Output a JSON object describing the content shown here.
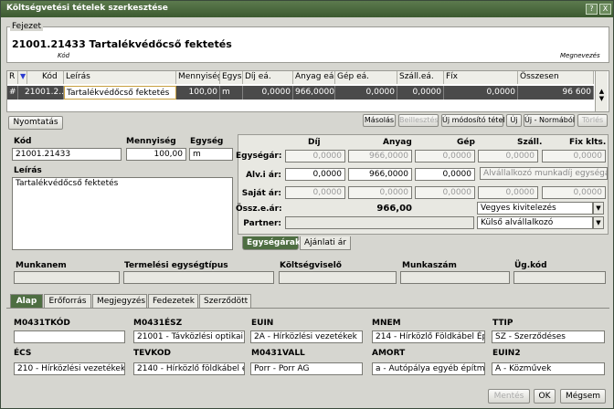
{
  "window": {
    "title": "Költségvetési tételek szerkesztése",
    "btn_help": "?",
    "btn_close": "X"
  },
  "fejezet": {
    "label": "Fejezet",
    "title": "21001.21433 Tartalékvédőcső fektetés",
    "kod_label": "Kód",
    "megnevezes_label": "Megnevezés"
  },
  "grid": {
    "headers": [
      "R",
      "",
      "Kód",
      "Leírás",
      "Mennyiség",
      "Egys.",
      "Díj eá.",
      "Anyag eá.",
      "Gép eá.",
      "Száll.eá.",
      "Fíx",
      "Összesen"
    ],
    "row": [
      "#",
      "",
      "21001.2...",
      "Tartalékvédőcső fektetés",
      "100,00",
      "m",
      "0,0000",
      "966,0000",
      "0,0000",
      "0,0000",
      "0,0000",
      "96 600"
    ]
  },
  "toolbar": {
    "print": "Nyomtatás",
    "masolas": "Másolás",
    "beillesztes": "Beillesztés",
    "uj_modosito": "Új módosító tétel",
    "uj": "Új",
    "uj_normabol": "Új - Normából",
    "torles": "Törlés"
  },
  "item": {
    "kod_label": "Kód",
    "kod": "21001.21433",
    "menny_label": "Mennyiség",
    "menny": "100,00",
    "egyseg_label": "Egység",
    "egyseg": "m",
    "leiras_label": "Leírás",
    "leiras": "Tartalékvédőcső fektetés"
  },
  "prices": {
    "cols": [
      "Díj",
      "Anyag",
      "Gép",
      "Száll.",
      "Fix klts."
    ],
    "rows": [
      {
        "label": "Egységár:",
        "vals": [
          "0,0000",
          "966,0000",
          "0,0000",
          "0,0000",
          "0,0000"
        ]
      },
      {
        "label": "Alv.i ár:",
        "vals": [
          "0,0000",
          "966,0000",
          "0,0000"
        ],
        "combo": "Alvállalkozó munkadíj egységár"
      },
      {
        "label": "Saját ár:",
        "vals": [
          "0,0000",
          "0,0000",
          "0,0000",
          "0,0000",
          "0,0000"
        ]
      }
    ],
    "ossz_label": "Össz.e.ár:",
    "ossz": "966,00",
    "partner_label": "Partner:",
    "vegyes": "Vegyes kivitelezés",
    "kulso": "Külső alvállalkozó",
    "tab_egysegarak": "Egységárak",
    "tab_ajanlati": "Ajánlati ár"
  },
  "meta": {
    "munkanem": "Munkanem",
    "termelesi": "Termelési egységtípus",
    "koltsegviselo": "Költségviselő",
    "munkaszam": "Munkaszám",
    "ugkod": "Üg.kód"
  },
  "tabs": [
    "Alap",
    "Erőforrás",
    "Megjegyzés",
    "Fedezetek",
    "Szerződött"
  ],
  "alap": [
    {
      "label": "M0431TKÓD",
      "value": ""
    },
    {
      "label": "M0431ÉSZ",
      "value": "21001 - Távközlési optikai"
    },
    {
      "label": "EUIN",
      "value": "2A - Hírközlési vezetékek"
    },
    {
      "label": "MNEM",
      "value": "214 - Hírközlő Földkábel Ép"
    },
    {
      "label": "TTIP",
      "value": "SZ - Szerződéses"
    },
    {
      "label": "ÉCS",
      "value": "210 - Hírközlési vezetékek"
    },
    {
      "label": "TEVKOD",
      "value": "2140 - Hírközlő földkábel é"
    },
    {
      "label": "M0431VALL",
      "value": "Porr - Porr AG"
    },
    {
      "label": "AMORT",
      "value": "a - Autópálya egyéb építm"
    },
    {
      "label": "EUIN2",
      "value": "A - Közművek"
    }
  ],
  "footer": {
    "mentes": "Mentés",
    "ok": "OK",
    "megsem": "Mégsem"
  }
}
